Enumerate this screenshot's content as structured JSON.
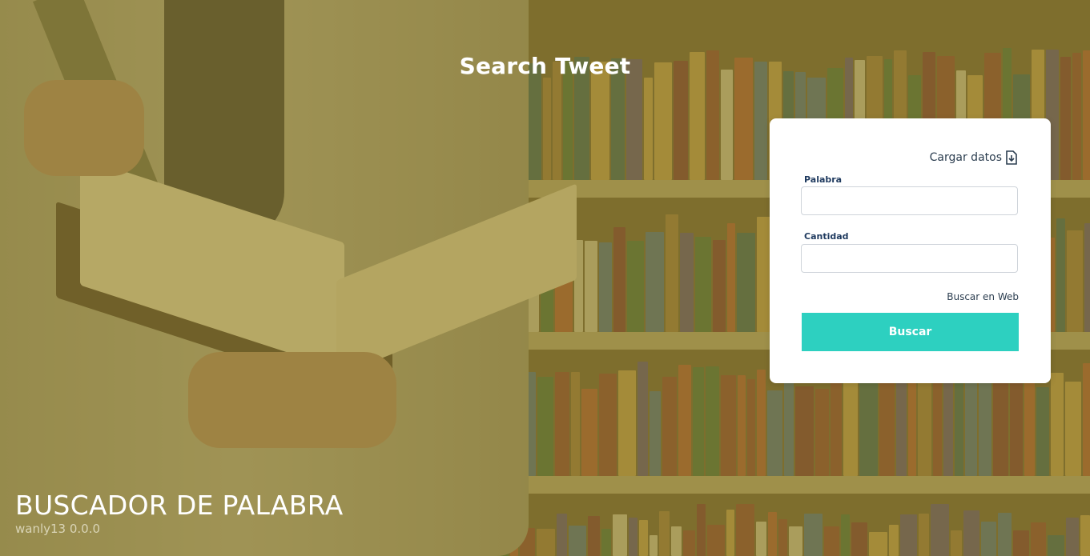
{
  "header": {
    "title": "Search Tweet"
  },
  "form": {
    "load_label": "Cargar datos",
    "load_icon": "download-file-icon",
    "word_label": "Palabra",
    "word_value": "",
    "amount_label": "Cantidad",
    "amount_value": "",
    "web_search_label": "Buscar en Web",
    "search_button_label": "Buscar",
    "accent_color": "#2dd0c0"
  },
  "footer": {
    "title": "BUSCADOR DE PALABRA",
    "version": "wanly13 0.0.0"
  }
}
